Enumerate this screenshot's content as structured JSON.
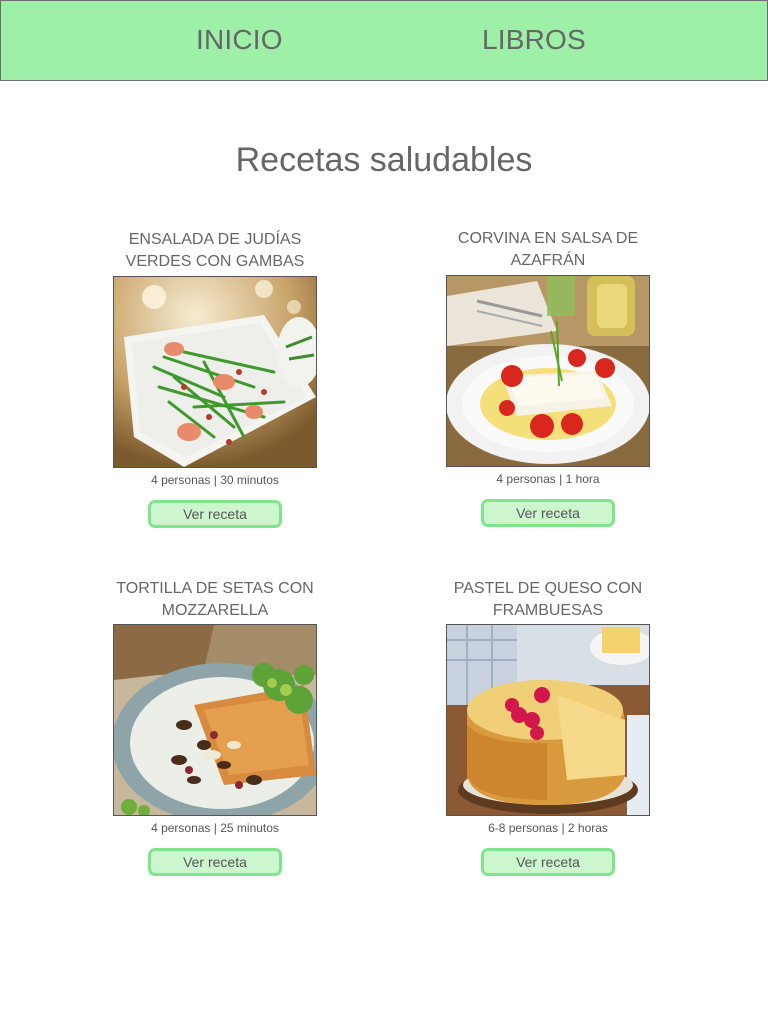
{
  "nav": {
    "items": [
      {
        "label": "INICIO"
      },
      {
        "label": "LIBROS"
      }
    ]
  },
  "page": {
    "title": "Recetas saludables"
  },
  "recipes": [
    {
      "title_line1": "ENSALADA DE JUDÍAS",
      "title_line2": "VERDES CON GAMBAS",
      "meta": "4 personas | 30 minutos",
      "button_label": "Ver receta",
      "image": "green-bean-shrimp-salad-photo"
    },
    {
      "title_line1": "CORVINA EN SALSA DE",
      "title_line2": "AZAFRÁN",
      "meta": "4 personas | 1 hora",
      "button_label": "Ver receta",
      "image": "sea-bass-saffron-sauce-photo"
    },
    {
      "title_line1": "TORTILLA DE SETAS CON",
      "title_line2": "MOZZARELLA",
      "meta": "4 personas | 25 minutos",
      "button_label": "Ver receta",
      "image": "mushroom-omelette-photo"
    },
    {
      "title_line1": "PASTEL DE QUESO CON",
      "title_line2": "FRAMBUESAS",
      "meta": "6-8 personas | 2 horas",
      "button_label": "Ver receta",
      "image": "raspberry-cheesecake-photo"
    }
  ],
  "colors": {
    "nav_background": "#9ef0a8",
    "button_background": "#cdf6cf",
    "button_border": "#7fe58b",
    "text": "#666666"
  }
}
